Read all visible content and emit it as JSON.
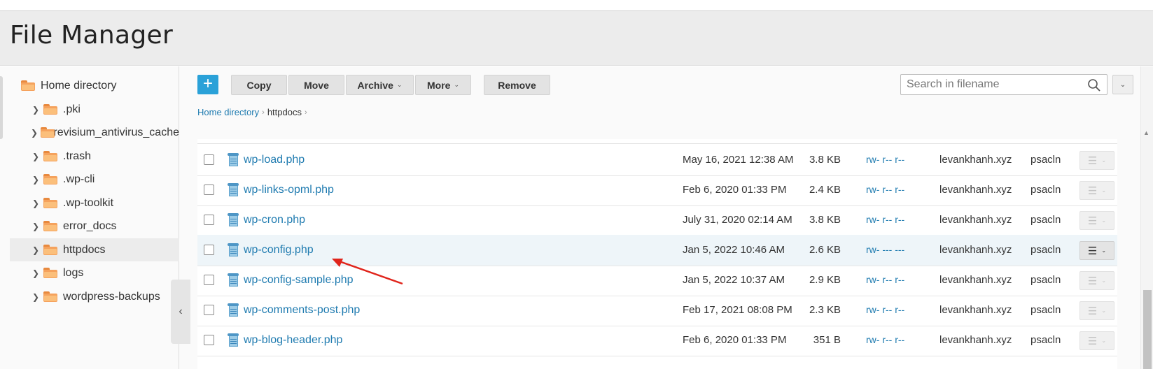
{
  "page_title": "File Manager",
  "sidebar": {
    "root": "Home directory",
    "items": [
      {
        "label": ".pki"
      },
      {
        "label": ".revisium_antivirus_cache"
      },
      {
        "label": ".trash"
      },
      {
        "label": ".wp-cli"
      },
      {
        "label": ".wp-toolkit"
      },
      {
        "label": "error_docs"
      },
      {
        "label": "httpdocs",
        "active": true
      },
      {
        "label": "logs"
      },
      {
        "label": "wordpress-backups"
      }
    ],
    "collapse_glyph": "‹"
  },
  "toolbar": {
    "add_label": "+",
    "copy_label": "Copy",
    "move_label": "Move",
    "archive_label": "Archive",
    "more_label": "More",
    "remove_label": "Remove",
    "caret": "⌄"
  },
  "search": {
    "placeholder": "Search in filename"
  },
  "breadcrumb": {
    "home": "Home directory",
    "current": "httpdocs",
    "sep": "›"
  },
  "files": [
    {
      "name": "wp-load.php",
      "modified": "May 16, 2021 12:38 AM",
      "size": "3.8 KB",
      "perms": "rw- r-- r--",
      "owner": "levankhanh.xyz",
      "group": "psacln"
    },
    {
      "name": "wp-links-opml.php",
      "modified": "Feb 6, 2020 01:33 PM",
      "size": "2.4 KB",
      "perms": "rw- r-- r--",
      "owner": "levankhanh.xyz",
      "group": "psacln"
    },
    {
      "name": "wp-cron.php",
      "modified": "July 31, 2020 02:14 AM",
      "size": "3.8 KB",
      "perms": "rw- r-- r--",
      "owner": "levankhanh.xyz",
      "group": "psacln"
    },
    {
      "name": "wp-config.php",
      "modified": "Jan 5, 2022 10:46 AM",
      "size": "2.6 KB",
      "perms": "rw- --- ---",
      "owner": "levankhanh.xyz",
      "group": "psacln",
      "highlighted": true
    },
    {
      "name": "wp-config-sample.php",
      "modified": "Jan 5, 2022 10:37 AM",
      "size": "2.9 KB",
      "perms": "rw- r-- r--",
      "owner": "levankhanh.xyz",
      "group": "psacln"
    },
    {
      "name": "wp-comments-post.php",
      "modified": "Feb 17, 2021 08:08 PM",
      "size": "2.3 KB",
      "perms": "rw- r-- r--",
      "owner": "levankhanh.xyz",
      "group": "psacln"
    },
    {
      "name": "wp-blog-header.php",
      "modified": "Feb 6, 2020 01:33 PM",
      "size": "351 B",
      "perms": "rw- r-- r--",
      "owner": "levankhanh.xyz",
      "group": "psacln"
    }
  ],
  "colors": {
    "accent": "#2aa1d8",
    "link": "#1f7bb0",
    "folder": "#f5a25d",
    "annotation_arrow": "#e0241b"
  },
  "icons": {
    "row_menu": "hamburger-icon",
    "file": "php-file-icon",
    "folder": "folder-icon",
    "search": "search-icon"
  }
}
